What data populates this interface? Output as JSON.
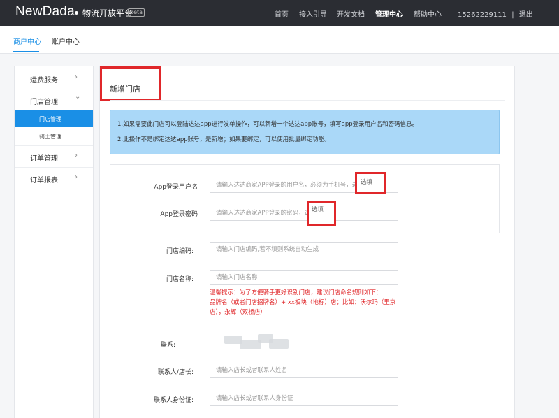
{
  "header": {
    "logo": "NewDada",
    "platform": "物流开放平台",
    "beta": "beta",
    "nav": [
      "首页",
      "接入引导",
      "开发文档",
      "管理中心",
      "帮助中心"
    ],
    "active_nav": "管理中心",
    "phone": "15262229111",
    "separator": "|",
    "logout": "退出"
  },
  "subtabs": [
    "商户中心",
    "账户中心"
  ],
  "sidebar": {
    "items": [
      {
        "label": "运费服务",
        "chevron": "›"
      },
      {
        "label": "门店管理",
        "chevron": "⌄"
      },
      {
        "label": "订单管理",
        "chevron": "›"
      },
      {
        "label": "订单报表",
        "chevron": "›"
      }
    ],
    "sub_items": [
      "门店管理",
      "骑士管理"
    ]
  },
  "panel": {
    "title": "新增门店",
    "info_lines": [
      "1.如果需要此门店可以登陆达达app进行发单操作，可以新增一个达达app账号，填写app登录用户名和密码信息。",
      "2.此操作不是绑定达达app账号，是新增；如果要绑定，可以使用批量绑定功能。"
    ]
  },
  "form": {
    "app_user_label": "App登录用户名",
    "app_user_placeholder": "请输入达达商家APP登录的用户名，必须为手机号，选填",
    "app_user_overlay": "选填",
    "app_pwd_label": "App登录密码",
    "app_pwd_placeholder": "请输入达达商家APP登录的密码，选填",
    "app_pwd_overlay": "选填",
    "store_code_label": "门店编码:",
    "store_code_placeholder": "请输入门店编码,若不填则系统自动生成",
    "store_name_label": "门店名称:",
    "store_name_placeholder": "请输入门店名称",
    "hint_lines": [
      "温馨提示：为了方便骑手更好识别门店，建议门店命名规则如下：",
      "品牌名（或者门店招牌名）+ xx板块（地标）店；比如：沃尔玛（里京",
      "店），永辉（双桥店）"
    ],
    "contact_label": "联系:",
    "manager_label": "联系人/店长:",
    "manager_placeholder": "请输入店长或者联系人姓名",
    "id_label": "联系人身份证:",
    "id_placeholder": "请输入店长或者联系人身份证"
  }
}
